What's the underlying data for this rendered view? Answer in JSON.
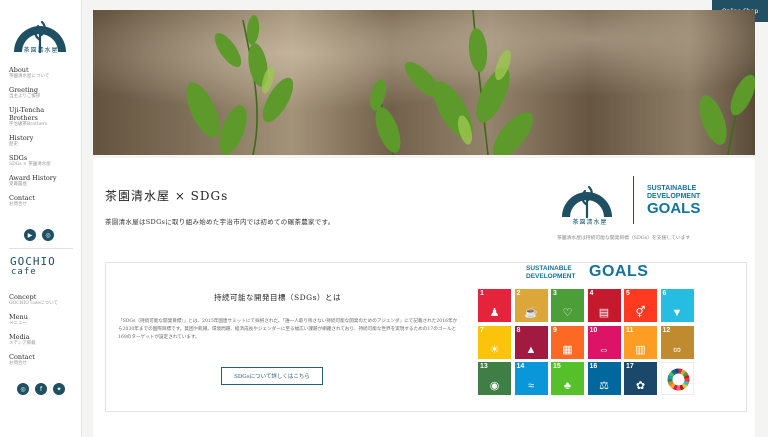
{
  "brand": {
    "name": "茶園清水屋"
  },
  "header": {
    "shop_label": "Online Shop"
  },
  "sidebar": {
    "items": [
      {
        "en": "About",
        "ja": "茶園清水屋について"
      },
      {
        "en": "Greeting",
        "ja": "当主よりご挨拶"
      },
      {
        "en": "Uji-Tencha Brothers",
        "ja": "宇治碾茶Brothers"
      },
      {
        "en": "History",
        "ja": "歴史"
      },
      {
        "en": "SDGs",
        "ja": "SDGs × 茶園清水屋"
      },
      {
        "en": "Award History",
        "ja": "受賞履歴"
      },
      {
        "en": "Contact",
        "ja": "お問合せ"
      }
    ],
    "gochio_line1": "GOCHIO",
    "gochio_line2": "cafe",
    "items2": [
      {
        "en": "Concept",
        "ja": "GOCHIO cafeについて"
      },
      {
        "en": "Menu",
        "ja": "メニュー"
      },
      {
        "en": "Media",
        "ja": "メディア掲載"
      },
      {
        "en": "Contact",
        "ja": "お問合せ"
      }
    ]
  },
  "main": {
    "sdgs_title": "茶園清水屋 × SDGs",
    "sdgs_lead": "茶園清水屋はSDGsに取り組み始めた宇治市内では初めての碾茶農家です。",
    "goals_logo": {
      "line1": "SUSTAINABLE",
      "line2": "DEVELOPMENT",
      "line3": "GOALS"
    },
    "support_text": "茶園清水屋は持続可能な開発目標（SDGs）を支援しています",
    "inner": {
      "title": "持続可能な開発目標（SDGs）とは",
      "description": "「SDGs（持続可能な開発目標）」とは、2015年国連サミットにて採択された、「誰一人取り残さない持続可能な開発のためのアジェンダ」にて記載された2016年から2030年までの国際目標です。貧困や飢餓、環境問題、経済成長やジェンダーに至る幅広い課題が網羅されており、持続可能な世界を実現するための17のゴールと169のターゲットが設定されています。",
      "button_label": "SDGsについて詳しくはこちら",
      "goals_head": {
        "a": "SUSTAINABLE",
        "b": "DEVELOPMENT",
        "c": "GOALS"
      }
    },
    "goals": [
      {
        "n": "1",
        "color": "#e5243b",
        "glyph": "♟"
      },
      {
        "n": "2",
        "color": "#dda63a",
        "glyph": "☕"
      },
      {
        "n": "3",
        "color": "#4c9f38",
        "glyph": "♡"
      },
      {
        "n": "4",
        "color": "#c5192d",
        "glyph": "▤"
      },
      {
        "n": "5",
        "color": "#ff3a21",
        "glyph": "⚥"
      },
      {
        "n": "6",
        "color": "#26bde2",
        "glyph": "▼"
      },
      {
        "n": "7",
        "color": "#fcc30b",
        "glyph": "☀"
      },
      {
        "n": "8",
        "color": "#a21942",
        "glyph": "▲"
      },
      {
        "n": "9",
        "color": "#fd6925",
        "glyph": "▦"
      },
      {
        "n": "10",
        "color": "#dd1367",
        "glyph": "⇔"
      },
      {
        "n": "11",
        "color": "#fd9d24",
        "glyph": "▥"
      },
      {
        "n": "12",
        "color": "#bf8b2e",
        "glyph": "∞"
      },
      {
        "n": "13",
        "color": "#3f7e44",
        "glyph": "◉"
      },
      {
        "n": "14",
        "color": "#0a97d9",
        "glyph": "≈"
      },
      {
        "n": "15",
        "color": "#56c02b",
        "glyph": "♣"
      },
      {
        "n": "16",
        "color": "#00689d",
        "glyph": "⚖"
      },
      {
        "n": "17",
        "color": "#19486a",
        "glyph": "✿"
      },
      {
        "n": "",
        "color": "#ffffff",
        "glyph": ""
      }
    ]
  }
}
